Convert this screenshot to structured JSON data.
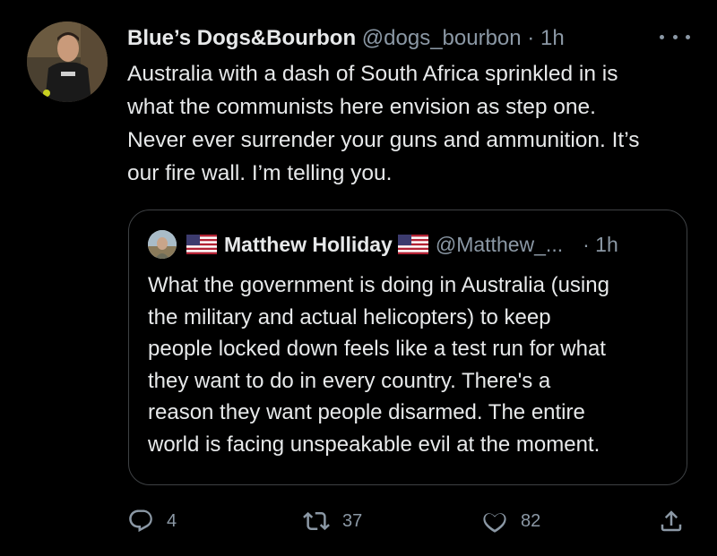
{
  "colors": {
    "background": "#000000",
    "text": "#e7e9ea",
    "secondary": "#8b98a5",
    "border": "#3e4144"
  },
  "tweet": {
    "display_name": "Blue’s Dogs&Bourbon",
    "handle": "@dogs_bourbon",
    "separator": "·",
    "time": "1h",
    "more_icon": "more-horizontal-icon",
    "body_lines": [
      "Australia with a dash of South Africa sprinkled in is",
      "what the communists here envision as step one.",
      "Never ever surrender your guns and ammunition. It’s",
      "our fire wall. I’m telling you."
    ]
  },
  "quote": {
    "display_name": "Matthew Holliday",
    "handle": "@Matthew_...",
    "separator": "·",
    "time": "1h",
    "flag_icon": "us-flag-icon",
    "body_lines": [
      "What the government is doing in Australia (using",
      "the military and actual helicopters) to keep",
      "people locked down feels like a test run for what",
      "they want to do in every country. There's a",
      "reason they want people disarmed. The entire",
      "world is facing unspeakable evil at the moment."
    ]
  },
  "actions": {
    "reply": {
      "icon": "reply-icon",
      "count": "4"
    },
    "retweet": {
      "icon": "retweet-icon",
      "count": "37"
    },
    "like": {
      "icon": "heart-icon",
      "count": "82"
    },
    "share": {
      "icon": "share-icon"
    }
  }
}
